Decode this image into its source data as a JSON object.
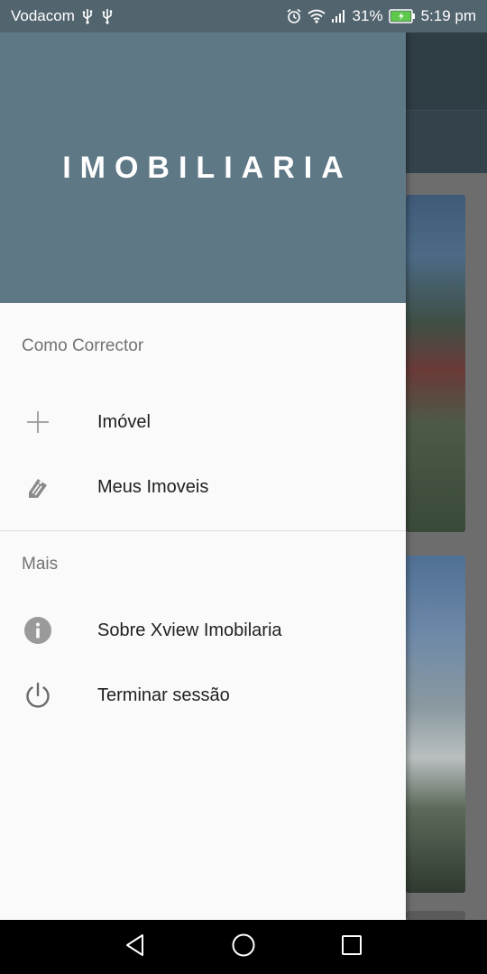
{
  "status_bar": {
    "carrier": "Vodacom",
    "battery_percent": "31%",
    "time": "5:19 pm"
  },
  "drawer": {
    "header_title": "IMOBILIARIA",
    "sections": [
      {
        "title": "Como Corrector",
        "items": [
          {
            "label": "Imóvel",
            "icon": "plus-icon"
          },
          {
            "label": "Meus Imoveis",
            "icon": "tag-edit-icon"
          }
        ]
      },
      {
        "title": "Mais",
        "items": [
          {
            "label": "Sobre Xview Imobilaria",
            "icon": "info-icon"
          },
          {
            "label": "Terminar sessão",
            "icon": "power-icon"
          }
        ]
      }
    ]
  },
  "colors": {
    "header_bg": "#5f7886",
    "status_bar_bg": "#52646e",
    "drawer_bg": "#fafafa",
    "icon_gray": "#8a8a8a"
  },
  "nav_bar": {
    "buttons": [
      "back-icon",
      "home-icon",
      "recents-icon"
    ]
  }
}
